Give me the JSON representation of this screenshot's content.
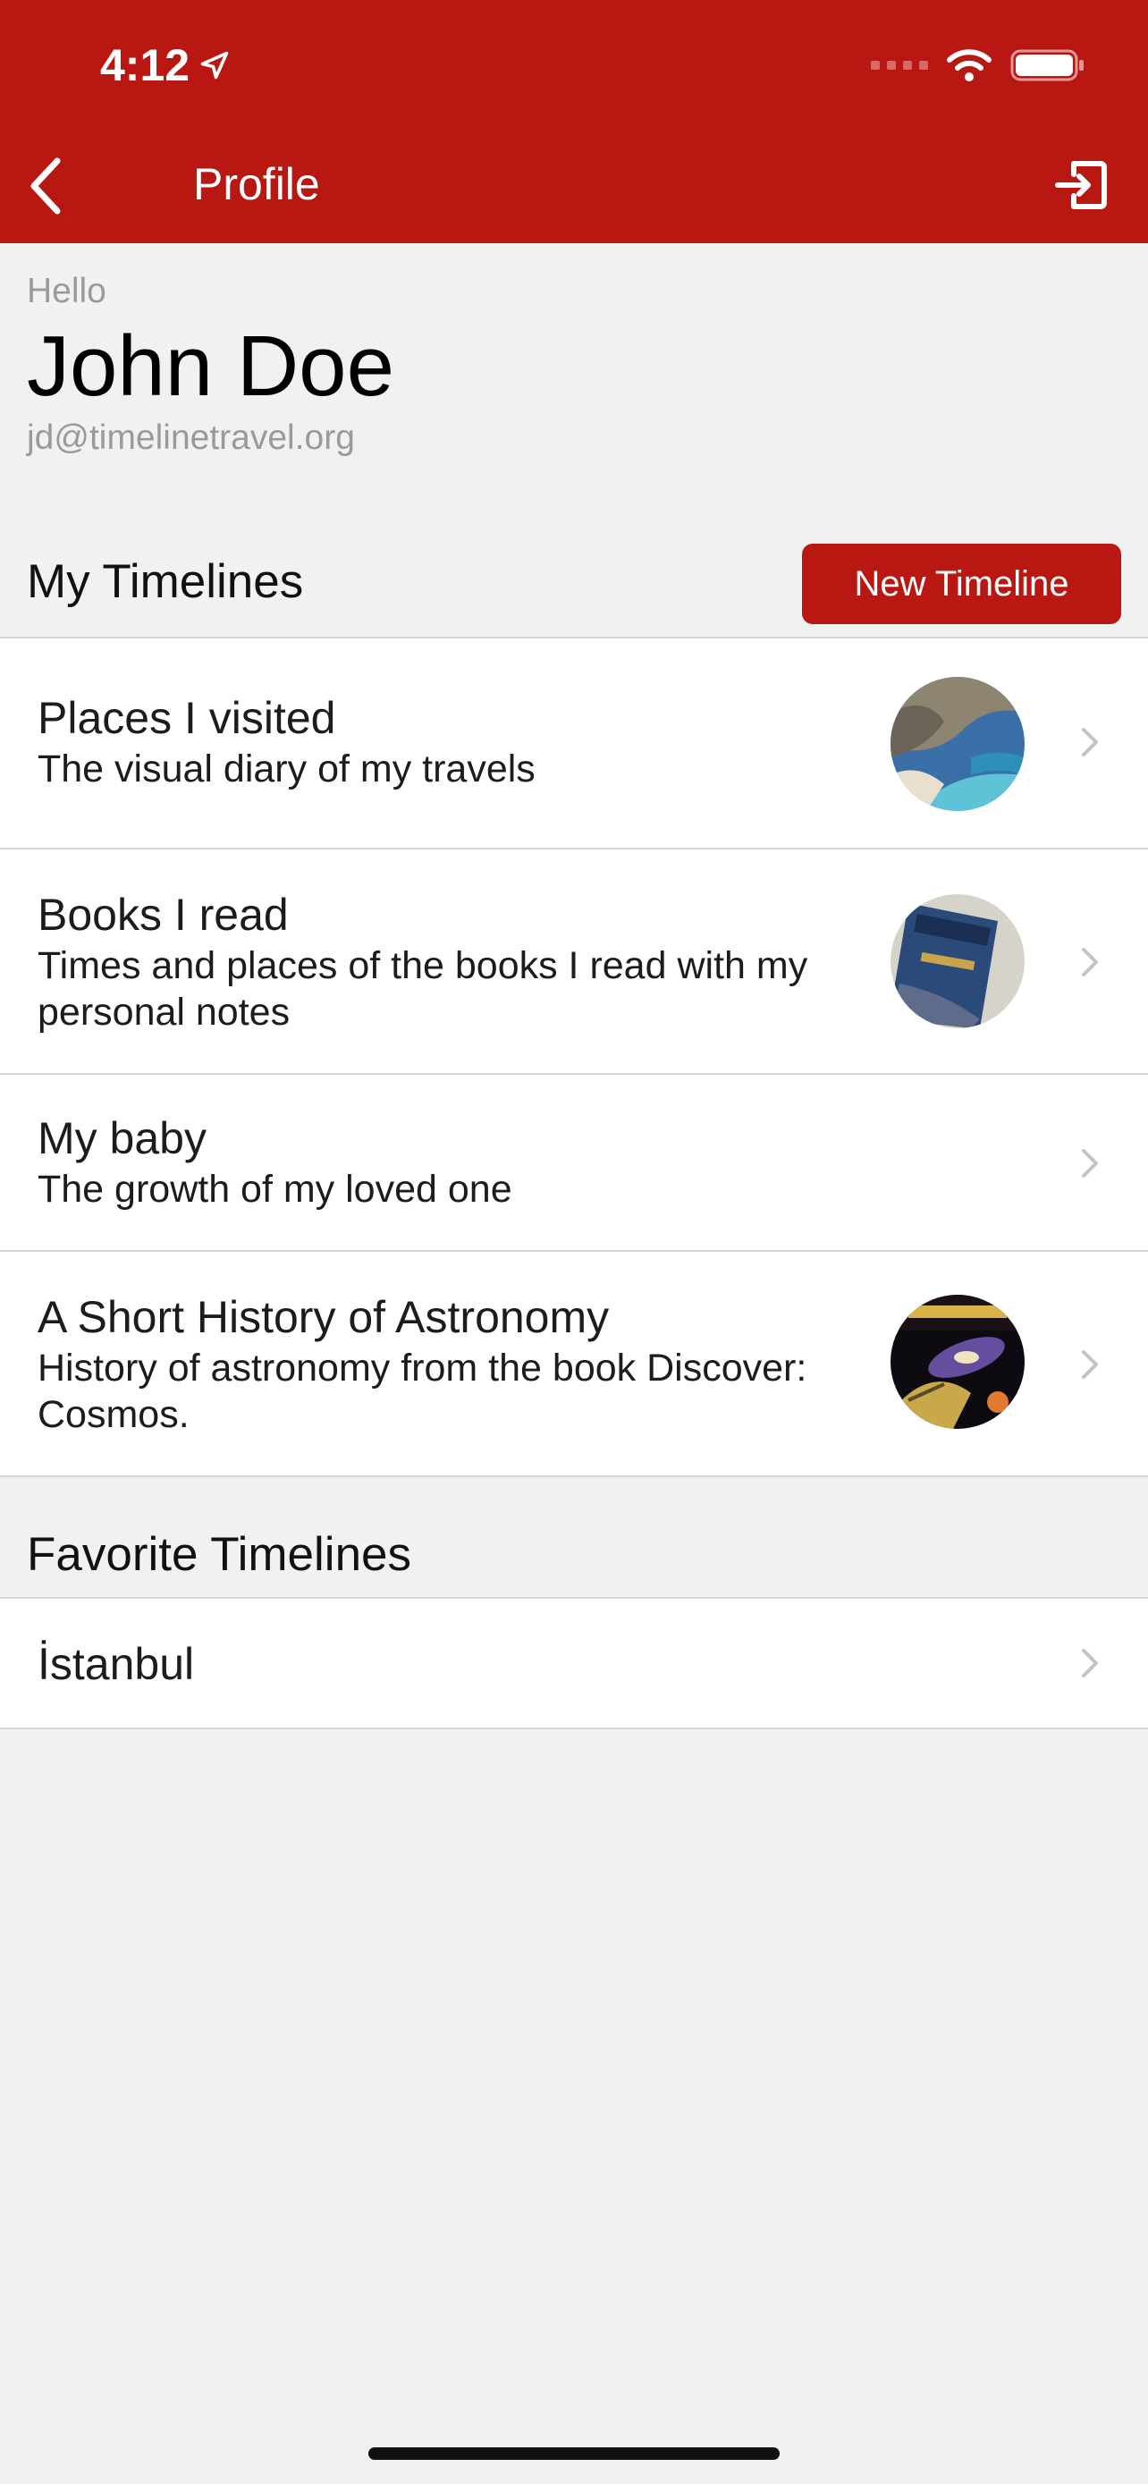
{
  "status_bar": {
    "time": "4:12"
  },
  "nav": {
    "title": "Profile",
    "back_icon": "chevron-left-icon",
    "logout_icon": "logout-icon"
  },
  "profile": {
    "greeting": "Hello",
    "name": "John Doe",
    "email": "jd@timelinetravel.org"
  },
  "my_timelines": {
    "title": "My Timelines",
    "new_button": "New Timeline",
    "items": [
      {
        "title": "Places I visited",
        "subtitle": "The visual diary of my travels",
        "thumbnail": "beach-photo"
      },
      {
        "title": "Books I read",
        "subtitle": "Times and places of the books I read with my personal notes",
        "thumbnail": "book-photo"
      },
      {
        "title": "My baby",
        "subtitle": "The growth of my loved one"
      },
      {
        "title": "A Short History of Astronomy",
        "subtitle": "History of astronomy from the book Discover: Cosmos.",
        "thumbnail": "cosmos-photo"
      }
    ]
  },
  "favorite_timelines": {
    "title": "Favorite Timelines",
    "items": [
      {
        "title": "İstanbul"
      }
    ]
  },
  "colors": {
    "brand": "#b91812",
    "background": "#f1f1f1",
    "separator": "#d8d8d8"
  }
}
